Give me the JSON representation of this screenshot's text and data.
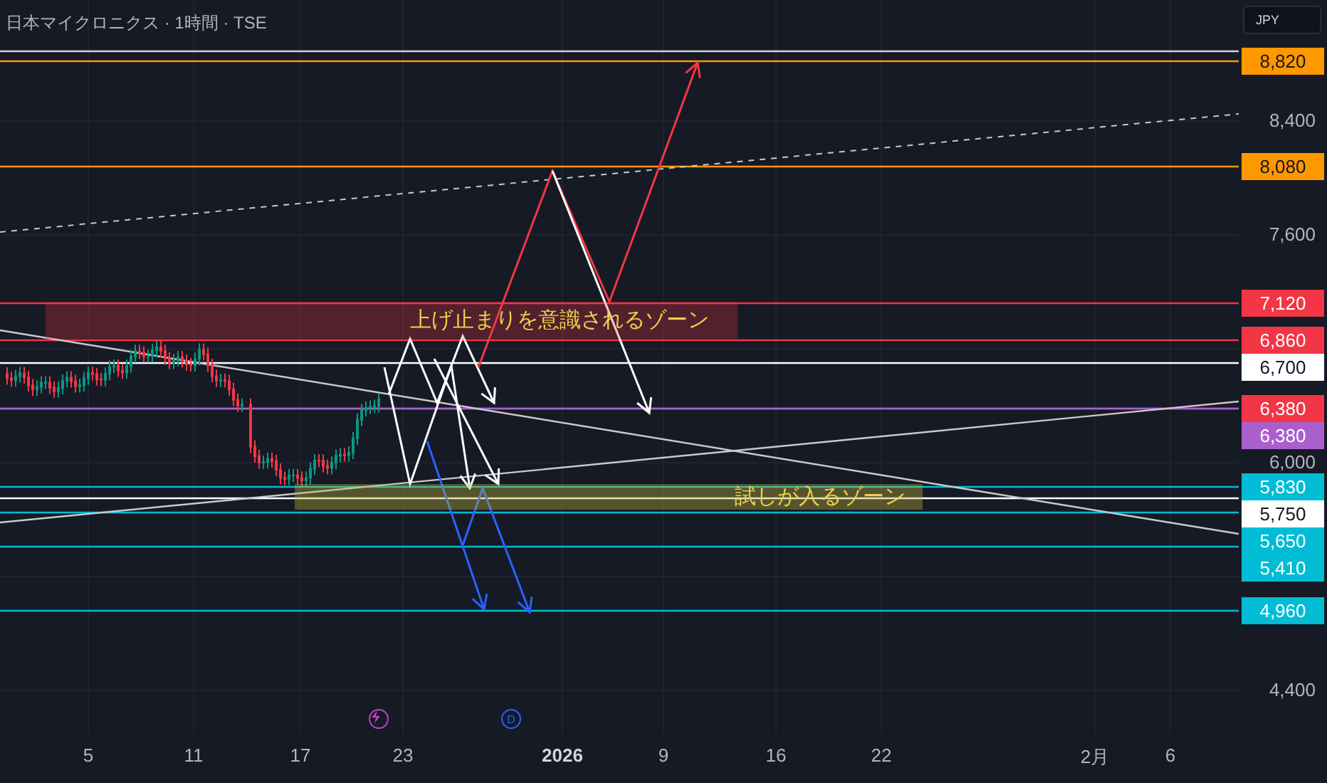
{
  "header": {
    "title": "日本マイクロニクス · 1時間 · TSE"
  },
  "currency_button": {
    "label": "JPY"
  },
  "zones": [
    {
      "kind": "resistance",
      "label": "上げ止まりを意識されるゾーン"
    },
    {
      "kind": "support",
      "label": "試しが入るゾーン"
    }
  ],
  "price_ticks": [
    "8,400",
    "7,600",
    "6,000",
    "4,400"
  ],
  "price_labels": [
    {
      "price": "8,820",
      "color": "#ff9800"
    },
    {
      "price": "8,080",
      "color": "#ff9800"
    },
    {
      "price": "7,120",
      "color": "#f23645"
    },
    {
      "price": "6,860",
      "color": "#f23645"
    },
    {
      "price": "6,700",
      "color": "#ffffff"
    },
    {
      "price": "6,380",
      "color": "#f23645"
    },
    {
      "price": "6,380",
      "color": "#ab5fcc"
    },
    {
      "price": "5,830",
      "color": "#00bcd4"
    },
    {
      "price": "5,750",
      "color": "#ffffff"
    },
    {
      "price": "5,650",
      "color": "#00bcd4"
    },
    {
      "price": "5,410",
      "color": "#00bcd4"
    },
    {
      "price": "4,960",
      "color": "#00bcd4"
    }
  ],
  "time_labels": [
    {
      "label": "5",
      "kind": "day"
    },
    {
      "label": "11",
      "kind": "day"
    },
    {
      "label": "17",
      "kind": "day"
    },
    {
      "label": "23",
      "kind": "day"
    },
    {
      "label": "2026",
      "kind": "year"
    },
    {
      "label": "9",
      "kind": "day"
    },
    {
      "label": "16",
      "kind": "day"
    },
    {
      "label": "22",
      "kind": "day"
    },
    {
      "label": "2月",
      "kind": "month"
    },
    {
      "label": "6",
      "kind": "day"
    }
  ],
  "events": [
    {
      "kind": "lightning"
    },
    {
      "kind": "letter",
      "label": "D"
    }
  ]
}
